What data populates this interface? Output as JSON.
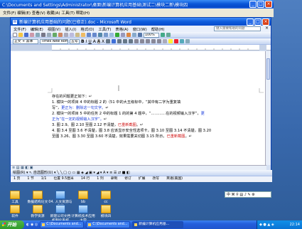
{
  "explorer": {
    "title": "C:\\Documents and Settings\\Administrator\\桌面\\新编计算机应用基础\\测试二\\模块二新\\模块四",
    "menu": "文件(F)  编辑(E)  查看(V)  收藏(A)  工具(T)  帮助(H)"
  },
  "word": {
    "title": "新编计算机应用基础的问题(已修正).doc - Microsoft Word",
    "menu": [
      "文件(F)",
      "编辑(E)",
      "视图(V)",
      "插入(I)",
      "格式(O)",
      "工具(T)",
      "表格(A)",
      "窗口(W)",
      "帮助(H)"
    ],
    "help_placeholder": "键入需要帮助的问题",
    "style_field": "正文 + 黑体",
    "font_field": "Times New Roman",
    "size_field": "五号",
    "zoom_field": "100%",
    "doc_lines": [
      {
        "parts": [
          {
            "t": "存在的问题更正如下：↵",
            "c": ""
          }
        ]
      },
      {
        "parts": [
          {
            "t": "1.  模块一的项目 4 中的标题 2 的（51 中的大五级标中，“其中有二字为重复填",
            "c": ""
          }
        ]
      },
      {
        "parts": [
          {
            "t": "    写”，",
            "c": ""
          },
          {
            "t": "更正为：删除这一句文字。",
            "c": "blue"
          },
          {
            "t": "↵",
            "c": ""
          }
        ]
      },
      {
        "parts": [
          {
            "t": "2.  模块一的项目 5 中的任务 2 中的标题 1 的的第 4 题中，“…………在的视频输入汉字”，",
            "c": ""
          },
          {
            "t": "更",
            "c": "blue"
          }
        ]
      },
      {
        "parts": [
          {
            "t": "    正为“在一定的视频输入汉字”。",
            "c": "blue"
          },
          {
            "t": "↵",
            "c": ""
          }
        ]
      },
      {
        "parts": [
          {
            "t": "3.  图 2.9、图 2.10 至图 2.12 不清楚，",
            "c": ""
          },
          {
            "t": "已重新截图",
            "c": "red"
          },
          {
            "t": "。↵",
            "c": ""
          }
        ]
      },
      {
        "parts": [
          {
            "t": "4.  图 3.4 至图 3.6 不清楚，图 3.8 应该显示安全性选项卡，图 3.10 至图 3.14 不清楚，图 3.20",
            "c": ""
          }
        ]
      },
      {
        "parts": [
          {
            "t": "    至图 3.26、图 3.30 至图 3.60 不清楚，效果需要关切图 3.15 所示。",
            "c": ""
          },
          {
            "t": "已重新截图",
            "c": "red"
          },
          {
            "t": "。↵",
            "c": ""
          }
        ]
      }
    ],
    "drawbar": "绘图(R) ▾  ↖  自选图形(U) ▾  ╲  ╲  □  ○  ▭  ▦  ◈  ◢  ▣  ▾  ◢  ▾  A  ▾  ≡  ☰  ⇄  ■  ◧",
    "status": [
      "1 页",
      "1 节",
      "1/1",
      "位置 9.5厘米",
      "14 行",
      "1 列",
      "录制",
      "修订",
      "扩展",
      "改写",
      "英语(美国)"
    ]
  },
  "desktop_icons": [
    {
      "label": "工具",
      "type": "folder"
    },
    {
      "label": "数据结构论文",
      "type": "folder"
    },
    {
      "label": "04. 人文资源与发展",
      "type": "doc"
    },
    {
      "label": "bb",
      "type": "folder"
    },
    {
      "label": "cc",
      "type": "folder"
    },
    {
      "label": "软件",
      "type": "folder"
    },
    {
      "label": "教学资源",
      "type": "folder"
    },
    {
      "label": "新建公司文档 机制化系统",
      "type": "doc"
    },
    {
      "label": "计算机技术应用大学",
      "type": "doc"
    },
    {
      "label": "模块四",
      "type": "folder"
    }
  ],
  "ime": "中 ⌘ ⚲ ▤ ♪ ✎ ⚙",
  "taskbar": {
    "start": "开始",
    "tasks": [
      "C:\\Documents and...",
      "C:\\Documents and...",
      "新编计算机应用基..."
    ],
    "clock": "22:14"
  }
}
